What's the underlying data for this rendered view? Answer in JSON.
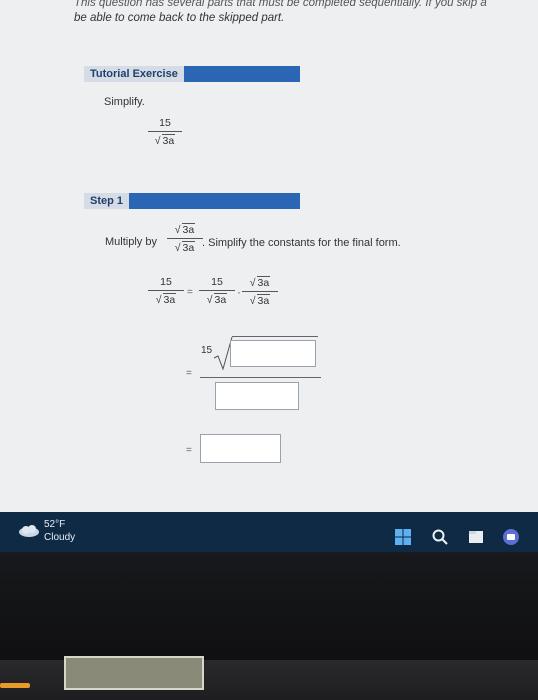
{
  "header": {
    "note_line1": "This question has several parts that must be completed sequentially. If you skip a",
    "note_line2": "be able to come back to the skipped part."
  },
  "tutorial": {
    "title": "Tutorial Exercise",
    "instruction": "Simplify.",
    "problem": {
      "numerator": "15",
      "denominator_radicand": "3a"
    }
  },
  "step": {
    "title": "Step 1",
    "multiply_by_label": "Multiply by",
    "multiplier": {
      "numerator_radicand": "3a",
      "denominator_radicand": "3a"
    },
    "instruction_tail": ". Simplify the constants for the final form.",
    "line1": {
      "lhs": {
        "numerator": "15",
        "denominator_radicand": "3a"
      },
      "eq": "=",
      "rhs_a": {
        "numerator": "15",
        "denominator_radicand": "3a"
      },
      "dot": "·",
      "rhs_b": {
        "numerator_radicand": "3a",
        "denominator_radicand": "3a"
      }
    },
    "line2": {
      "eq": "=",
      "coefficient": "15"
    },
    "line3": {
      "eq": "="
    }
  },
  "taskbar": {
    "temperature": "52°F",
    "condition": "Cloudy",
    "icons": [
      "windows-start-icon",
      "search-icon",
      "file-explorer-icon",
      "teams-icon"
    ]
  },
  "colors": {
    "banner": "#2b66b4",
    "taskbar": "#0f2a45",
    "screen_bg": "#eeeff0"
  }
}
